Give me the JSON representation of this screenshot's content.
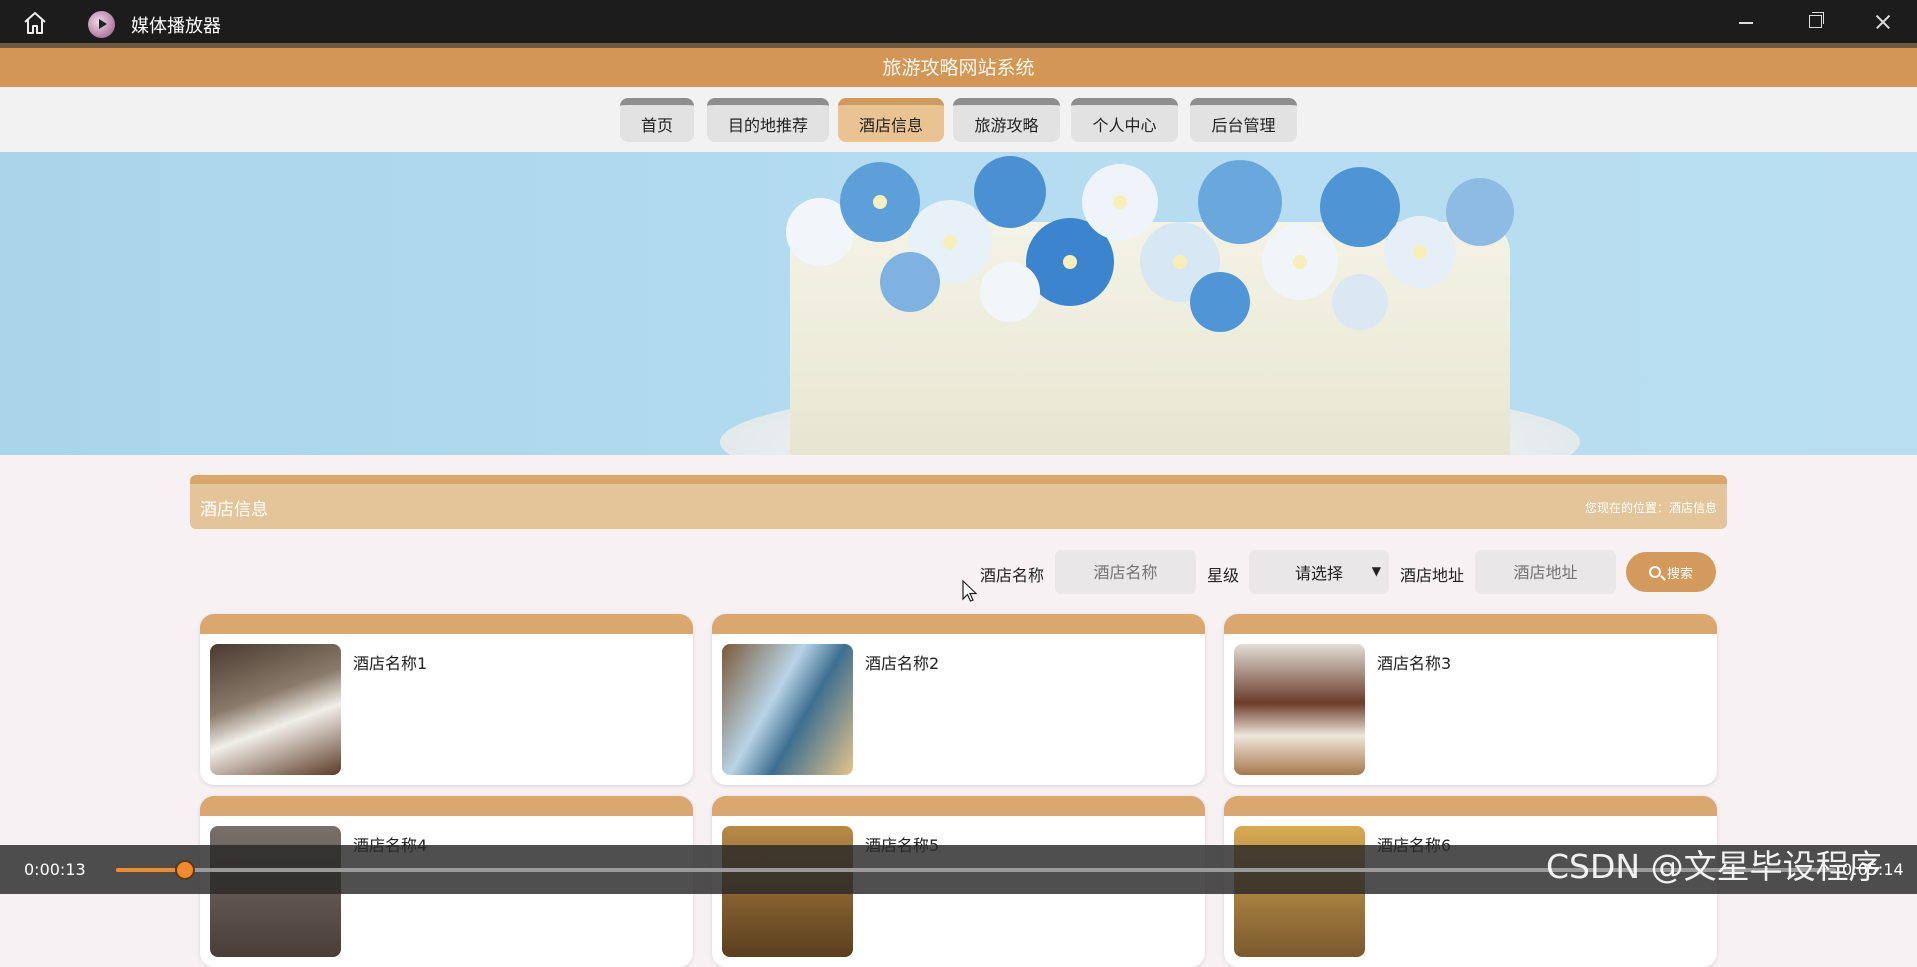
{
  "window": {
    "app_title": "媒体播放器"
  },
  "site": {
    "title": "旅游攻略网站系统"
  },
  "nav": {
    "items": [
      {
        "label": "首页",
        "active": false
      },
      {
        "label": "目的地推荐",
        "active": false
      },
      {
        "label": "酒店信息",
        "active": true
      },
      {
        "label": "旅游攻略",
        "active": false
      },
      {
        "label": "个人中心",
        "active": false
      },
      {
        "label": "后台管理",
        "active": false
      }
    ]
  },
  "panel": {
    "title": "酒店信息",
    "breadcrumb": "您现在的位置：酒店信息"
  },
  "search": {
    "name_label": "酒店名称",
    "name_placeholder": "酒店名称",
    "star_label": "星级",
    "star_selected": "请选择",
    "address_label": "酒店地址",
    "address_placeholder": "酒店地址",
    "button_label": "搜索"
  },
  "hotels": [
    {
      "name": "酒店名称1"
    },
    {
      "name": "酒店名称2"
    },
    {
      "name": "酒店名称3"
    },
    {
      "name": "酒店名称4"
    },
    {
      "name": "酒店名称5"
    },
    {
      "name": "酒店名称6"
    }
  ],
  "player": {
    "current_time": "0:00:13",
    "end_time": "0:05:14",
    "progress": 0.04
  },
  "watermark": "CSDN @文星毕设程序",
  "colors": {
    "accent": "#d39655",
    "progress": "#f08a2c",
    "titlebar": "#1c1c1c"
  }
}
